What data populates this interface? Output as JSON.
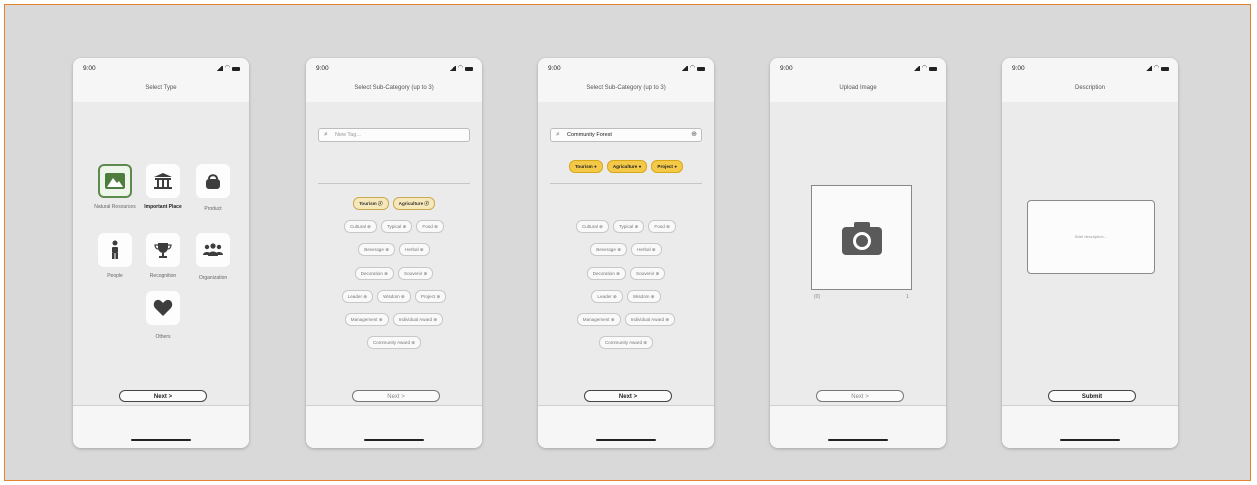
{
  "status": {
    "time": "9:00"
  },
  "screens": [
    {
      "title": "Select Type",
      "categories": [
        {
          "label": "Natural Resources",
          "icon": "mountain-icon"
        },
        {
          "label": "Important Place",
          "icon": "landmark-icon"
        },
        {
          "label": "Product",
          "icon": "bag-icon"
        },
        {
          "label": "People",
          "icon": "person-icon"
        },
        {
          "label": "Recognition",
          "icon": "trophy-icon"
        },
        {
          "label": "Organization",
          "icon": "group-icon"
        },
        {
          "label": "Others",
          "icon": "heart-icon"
        }
      ],
      "button": "Next  >"
    },
    {
      "title": "Select Sub-Category (up to 3)",
      "search_placeholder": "New Tag...",
      "selected_tags": [
        "Tourism",
        "Agriculture"
      ],
      "tags": [
        "Cultural",
        "Typical",
        "Food",
        "Beverage",
        "Herbal",
        "Decoration",
        "Souvenir",
        "Leader",
        "Wisdom",
        "Project",
        "Management",
        "Individual Award",
        "Community Award"
      ],
      "button": "Next  >"
    },
    {
      "title": "Select Sub-Category (up to 3)",
      "search_value": "Community Forest",
      "selected_tags": [
        "Tourism",
        "Agriculture",
        "Project"
      ],
      "tags": [
        "Cultural",
        "Typical",
        "Food",
        "Beverage",
        "Herbal",
        "Decoration",
        "Souvenir",
        "Leader",
        "Wisdom",
        "Management",
        "Individual Award",
        "Community Award"
      ],
      "button": "Next  >"
    },
    {
      "title": "Upload Image",
      "image_caption_left": "(0)",
      "image_caption_right": "1",
      "button": "Next  >"
    },
    {
      "title": "Description",
      "description_placeholder": "Brief description...",
      "button": "Submit"
    }
  ],
  "colors": {
    "frame_border": "#e3832f",
    "selected_tile": "#5d8a4e",
    "tag_gold": "#f5c948",
    "tag_selected": "#f6e8b8"
  }
}
